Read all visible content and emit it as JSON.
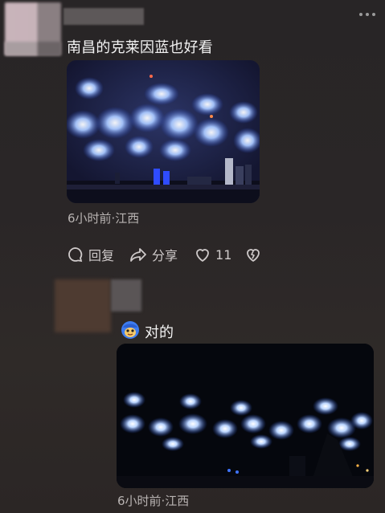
{
  "comment1": {
    "text": "南昌的克莱因蓝也好看",
    "meta": "6小时前·江西",
    "image_icon": "fireworks-over-city-skyline-photo"
  },
  "actions": {
    "reply_label": "回复",
    "share_label": "分享",
    "like_count": "11"
  },
  "comment2": {
    "emoji_icon": "blue-face-emoji",
    "text": "对的",
    "meta": "6小时前·江西",
    "image_icon": "fireworks-night-photo"
  },
  "colors": {
    "background": "#2a2627",
    "text": "#f2f2f2",
    "meta": "#b8b3b2",
    "firework_blue": "#6fa8ff"
  }
}
